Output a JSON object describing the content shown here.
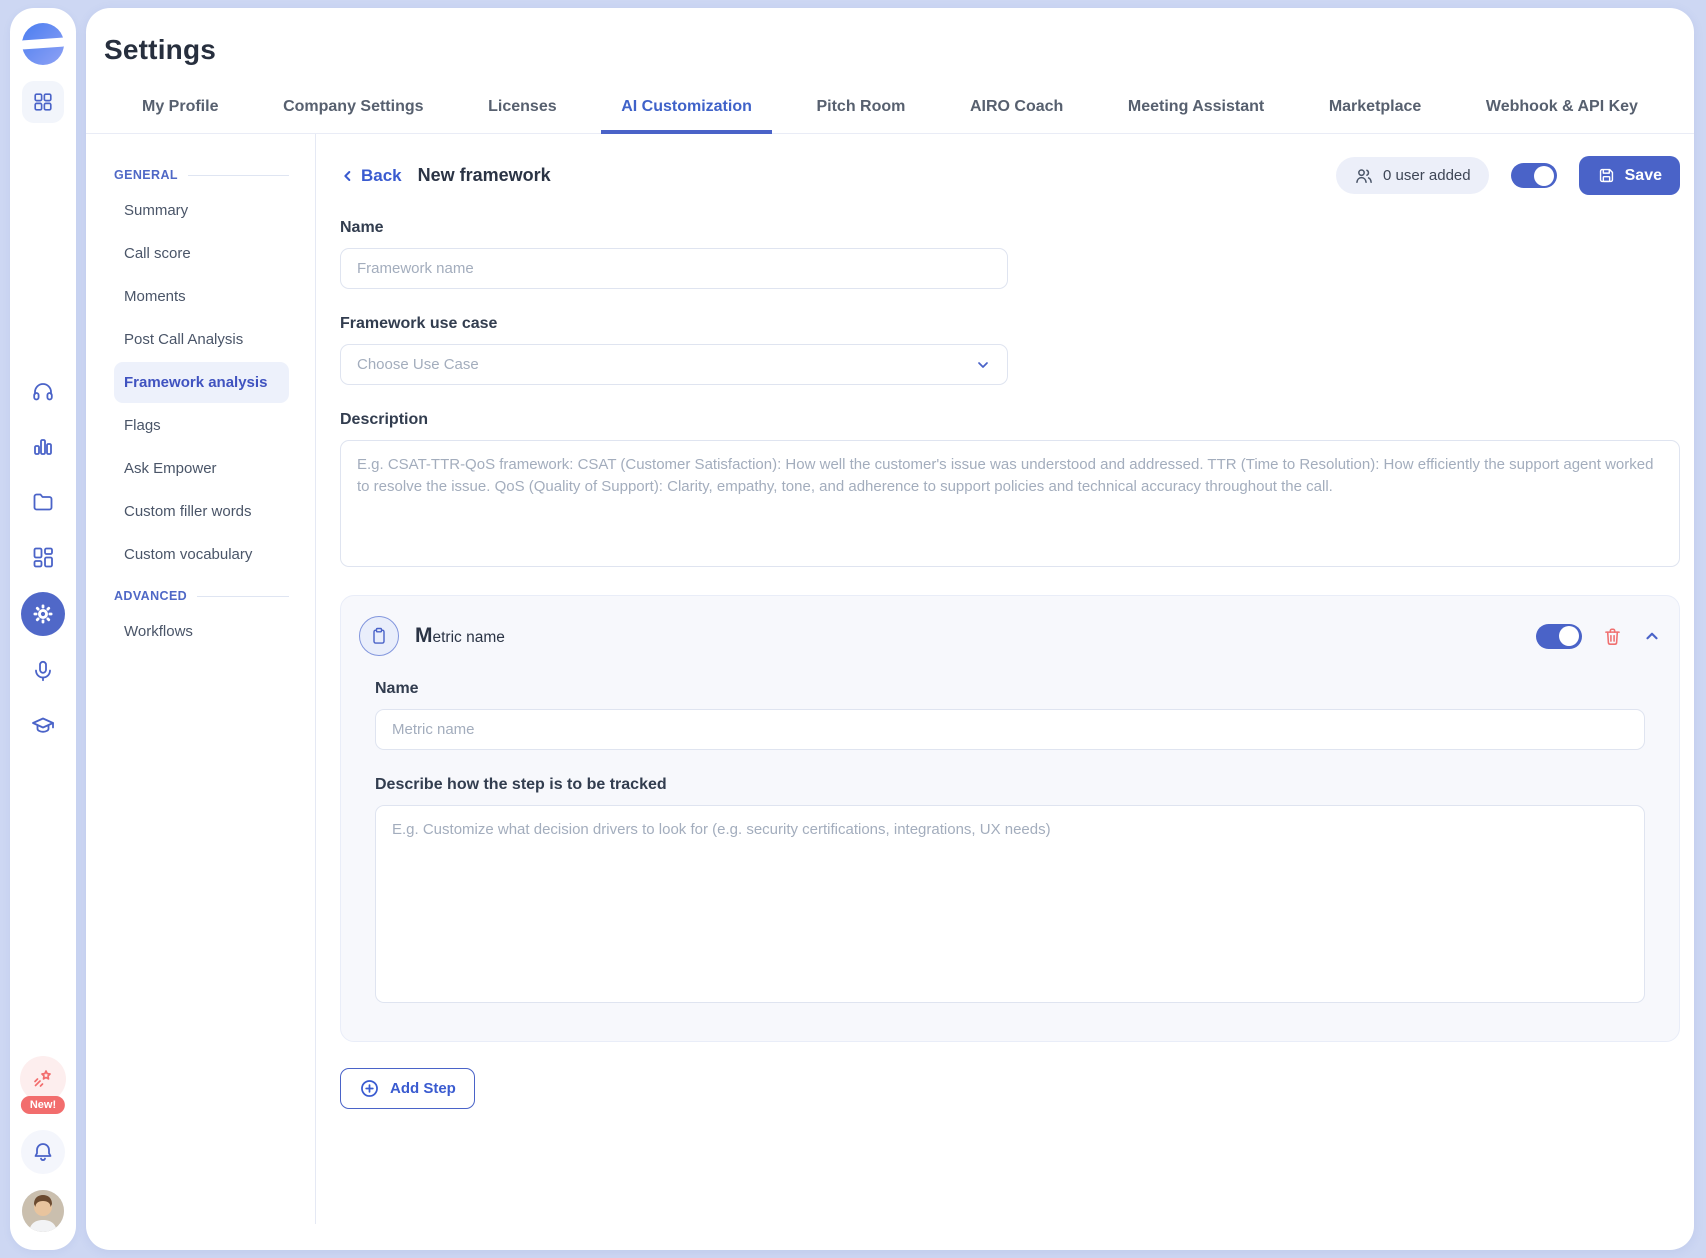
{
  "page": {
    "title": "Settings"
  },
  "tabs": [
    {
      "label": "My Profile",
      "active": false
    },
    {
      "label": "Company Settings",
      "active": false
    },
    {
      "label": "Licenses",
      "active": false
    },
    {
      "label": "AI Customization",
      "active": true
    },
    {
      "label": "Pitch Room",
      "active": false
    },
    {
      "label": "AIRO Coach",
      "active": false
    },
    {
      "label": "Meeting Assistant",
      "active": false
    },
    {
      "label": "Marketplace",
      "active": false
    },
    {
      "label": "Webhook & API Key",
      "active": false
    }
  ],
  "sidebar": {
    "general_label": "GENERAL",
    "items": [
      "Summary",
      "Call score",
      "Moments",
      "Post Call Analysis",
      "Framework analysis",
      "Flags",
      "Ask Empower",
      "Custom filler words",
      "Custom vocabulary"
    ],
    "active_item": "Framework analysis",
    "advanced_label": "ADVANCED",
    "advanced_items": [
      "Workflows"
    ]
  },
  "header": {
    "back_label": "Back",
    "title": "New framework",
    "users_badge": "0 user added",
    "toggle_on": true,
    "save_label": "Save"
  },
  "form": {
    "name_label": "Name",
    "name_placeholder": "Framework name",
    "name_value": "",
    "use_case_label": "Framework use case",
    "use_case_placeholder": "Choose Use Case",
    "description_label": "Description",
    "description_placeholder": "E.g. CSAT-TTR-QoS framework: CSAT (Customer Satisfaction): How well the customer's issue was understood and addressed. TTR (Time to Resolution): How efficiently the support agent worked to resolve the issue. QoS (Quality of Support): Clarity, empathy, tone, and adherence to support policies and technical accuracy throughout the call.",
    "description_value": ""
  },
  "metric": {
    "title": "Metric name",
    "toggle_on": true,
    "name_label": "Name",
    "name_placeholder": "Metric name",
    "name_value": "",
    "track_label": "Describe how the step is to be tracked",
    "track_placeholder": "E.g. Customize what decision drivers to look for (e.g. security certifications, integrations, UX needs)",
    "track_value": ""
  },
  "add_step_label": "Add Step",
  "rail": {
    "new_badge": "New!"
  },
  "colors": {
    "primary": "#4a63c8",
    "danger": "#f07070",
    "page_bg": "#cdd7f3",
    "active_nav_bg": "#edf1fb",
    "new_badge": "#f26d6d"
  }
}
